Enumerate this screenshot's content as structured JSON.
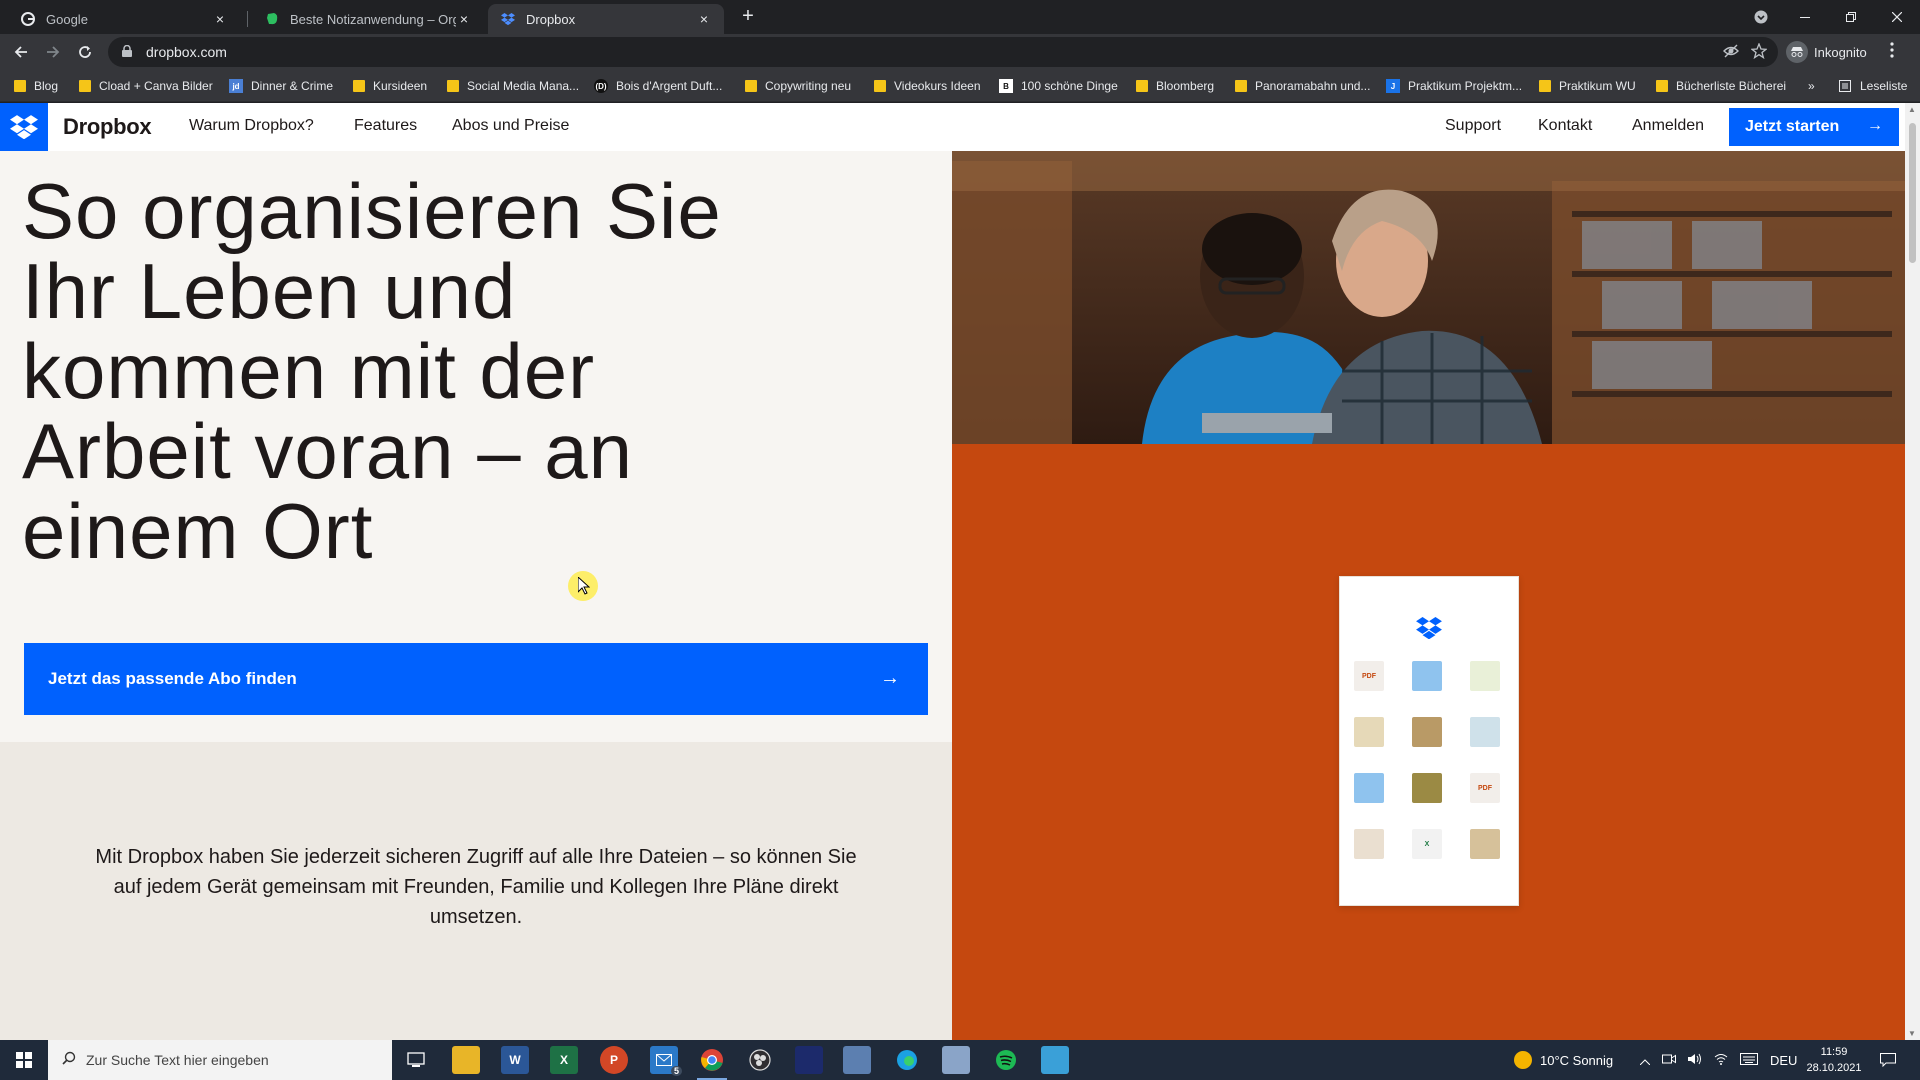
{
  "browser": {
    "tabs": [
      {
        "title": "Google",
        "favicon": "google-icon",
        "active": false
      },
      {
        "title": "Beste Notizanwendung – Organi",
        "favicon": "evernote-icon",
        "active": false
      },
      {
        "title": "Dropbox",
        "favicon": "dropbox-icon",
        "active": true
      }
    ],
    "close_glyph": "×",
    "new_tab_glyph": "+",
    "url": "dropbox.com",
    "profile_label": "Inkognito",
    "reading_list_label": "Leseliste",
    "bookmarks": [
      {
        "label": "Blog",
        "icon": "folder-icon"
      },
      {
        "label": "Cload + Canva Bilder",
        "icon": "folder-icon"
      },
      {
        "label": "Dinner & Crime",
        "icon": "jd-icon"
      },
      {
        "label": "Kursideen",
        "icon": "folder-icon"
      },
      {
        "label": "Social Media Mana...",
        "icon": "folder-icon"
      },
      {
        "label": "Bois d'Argent Duft...",
        "icon": "bois-icon"
      },
      {
        "label": "Copywriting neu",
        "icon": "folder-icon"
      },
      {
        "label": "Videokurs Ideen",
        "icon": "folder-icon"
      },
      {
        "label": "100 schöne Dinge",
        "icon": "b-icon"
      },
      {
        "label": "Bloomberg",
        "icon": "folder-icon"
      },
      {
        "label": "Panoramabahn und...",
        "icon": "folder-icon"
      },
      {
        "label": "Praktikum Projektm...",
        "icon": "j-icon"
      },
      {
        "label": "Praktikum WU",
        "icon": "folder-icon"
      },
      {
        "label": "Bücherliste Bücherei",
        "icon": "folder-icon"
      }
    ],
    "bookmarks_more": "»"
  },
  "site": {
    "brand": "Dropbox",
    "nav": [
      "Warum Dropbox?",
      "Features",
      "Abos und Preise"
    ],
    "nav_right": [
      "Support",
      "Kontakt",
      "Anmelden"
    ],
    "cta_top": "Jetzt starten",
    "hero_title_lines": [
      "So organisieren Sie",
      "Ihr Leben und",
      "kommen mit der",
      "Arbeit voran – an",
      "einem Ort"
    ],
    "cta_main": "Jetzt das passende Abo finden",
    "arrow_glyph": "→",
    "description": "Mit Dropbox haben Sie jederzeit sicheren Zugriff auf alle Ihre Dateien – so können Sie auf jedem Gerät gemeinsam mit Freunden, Familie und Kollegen Ihre Pläne direkt umsetzen.",
    "card_thumbs": [
      {
        "kind": "pdf",
        "label": "PDF"
      },
      {
        "kind": "folder",
        "label": ""
      },
      {
        "kind": "image",
        "label": ""
      },
      {
        "kind": "image",
        "label": ""
      },
      {
        "kind": "image",
        "label": ""
      },
      {
        "kind": "image",
        "label": ""
      },
      {
        "kind": "folder",
        "label": ""
      },
      {
        "kind": "image",
        "label": ""
      },
      {
        "kind": "pdf",
        "label": "PDF"
      },
      {
        "kind": "image",
        "label": ""
      },
      {
        "kind": "excel",
        "label": "X"
      },
      {
        "kind": "image",
        "label": ""
      }
    ]
  },
  "colors": {
    "brand_blue": "#0061fe",
    "hero_orange": "#c5480f",
    "page_bg": "#f7f5f2",
    "desc_bg": "#ede9e3"
  },
  "taskbar": {
    "search_placeholder": "Zur Suche Text hier eingeben",
    "apps": [
      "task-view-icon",
      "file-explorer-icon",
      "word-icon",
      "excel-icon",
      "powerpoint-icon",
      "mail-icon",
      "chrome-icon",
      "obs-icon",
      "app-icon",
      "photos-icon",
      "edge-icon",
      "notepad-icon",
      "spotify-icon",
      "photo-editor-icon"
    ],
    "mail_badge": "5",
    "weather": "10°C Sonnig",
    "language": "DEU",
    "time": "11:59",
    "date": "28.10.2021"
  }
}
